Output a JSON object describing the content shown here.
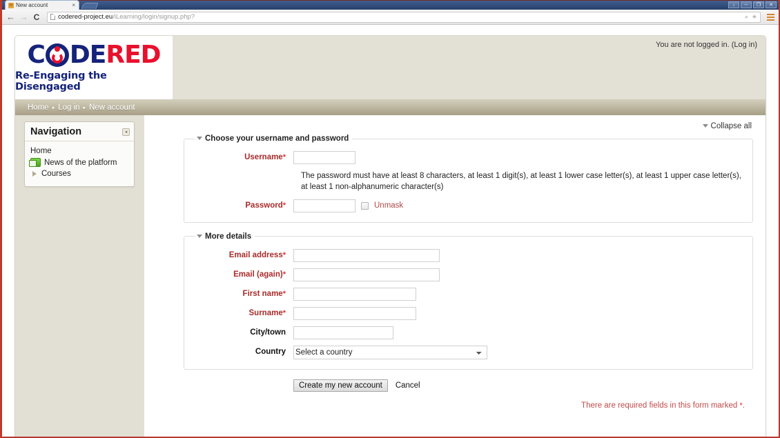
{
  "browser": {
    "tab_title": "New account",
    "tab_close_label": "×",
    "favicon_letter": "m",
    "back_icon": "←",
    "forward_icon": "→",
    "reload_icon": "C",
    "url_host": "codered-project.eu",
    "url_path": "/iLearning/login/signup.php?",
    "zoom_icon": "⌕",
    "bookmark_icon": "★",
    "window_buttons": [
      "↓",
      "─",
      "❐",
      "✕"
    ]
  },
  "header": {
    "logo_code": "C",
    "logo_de": "DE",
    "logo_red": "RED",
    "tagline": "Re-Engaging the Disengaged",
    "login_status": "You are not logged in.",
    "login_link": "(Log in)"
  },
  "breadcrumb": {
    "items": [
      "Home",
      "Log in",
      "New account"
    ],
    "separator": "▸"
  },
  "sidebar": {
    "block_title": "Navigation",
    "dock_icon": "◂",
    "items": [
      {
        "label": "Home",
        "icon": "none"
      },
      {
        "label": "News of the platform",
        "icon": "forum-icon"
      },
      {
        "label": "Courses",
        "icon": "expand-triangle-icon"
      }
    ]
  },
  "main": {
    "collapse_all": "Collapse all",
    "section_username": {
      "legend": "Choose your username and password",
      "username_label": "Username",
      "password_label": "Password",
      "required_marker": "*",
      "password_help": "The password must have at least 8 characters, at least 1 digit(s), at least 1 lower case letter(s), at least 1 upper case letter(s), at least 1 non-alphanumeric character(s)",
      "unmask_label": "Unmask",
      "username_value": "",
      "password_value": ""
    },
    "section_details": {
      "legend": "More details",
      "fields": [
        {
          "label": "Email address",
          "required": true,
          "value": "",
          "size": "xl"
        },
        {
          "label": "Email (again)",
          "required": true,
          "value": "",
          "size": "xl"
        },
        {
          "label": "First name",
          "required": true,
          "value": "",
          "size": "lg"
        },
        {
          "label": "Surname",
          "required": true,
          "value": "",
          "size": "lg"
        },
        {
          "label": "City/town",
          "required": false,
          "value": "",
          "size": "md"
        }
      ],
      "country_label": "Country",
      "country_selected": "Select a country"
    },
    "submit_label": "Create my new account",
    "cancel_label": "Cancel",
    "required_note": "There are required fields in this form marked ",
    "required_note_star": "*",
    "required_note_end": "."
  },
  "colors": {
    "brand_blue": "#15237a",
    "brand_red": "#e8112d",
    "header_beige": "#e3e0d6",
    "navbar_top": "#d2cdba",
    "navbar_bottom": "#a79f86",
    "required_label": "#a82b2b"
  }
}
